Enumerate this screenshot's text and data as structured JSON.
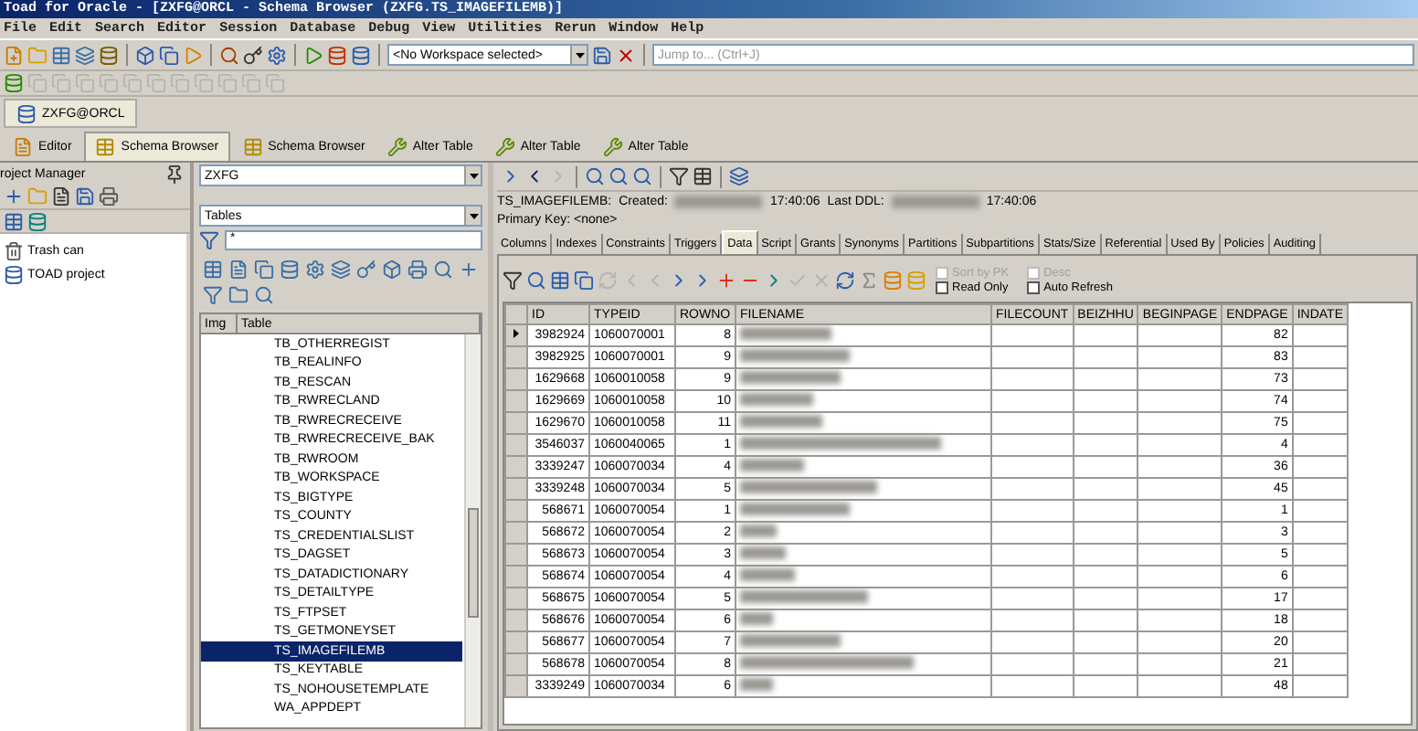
{
  "window": {
    "title": "Toad for Oracle - [ZXFG@ORCL - Schema Browser (ZXFG.TS_IMAGEFILEMB)]"
  },
  "menu": [
    "File",
    "Edit",
    "Search",
    "Editor",
    "Session",
    "Database",
    "Debug",
    "View",
    "Utilities",
    "Rerun",
    "Window",
    "Help"
  ],
  "toolbar": {
    "workspace": "<No Workspace selected>",
    "jump_placeholder": "Jump to... (Ctrl+J)"
  },
  "connection_tab": "ZXFG@ORCL",
  "doc_tabs": [
    {
      "label": "Editor",
      "kind": "editor",
      "selected": false
    },
    {
      "label": "Schema Browser",
      "kind": "schema",
      "selected": true
    },
    {
      "label": "Schema Browser",
      "kind": "schema",
      "selected": false
    },
    {
      "label": "Alter Table",
      "kind": "alter",
      "selected": false
    },
    {
      "label": "Alter Table",
      "kind": "alter",
      "selected": false
    },
    {
      "label": "Alter Table",
      "kind": "alter",
      "selected": false
    }
  ],
  "project_manager": {
    "title": "roject Manager",
    "items": [
      {
        "label": "Trash can",
        "kind": "trash"
      },
      {
        "label": "TOAD project",
        "kind": "project"
      }
    ]
  },
  "browser": {
    "schema": "ZXFG",
    "object_type": "Tables",
    "filter": "*",
    "columns": [
      "Img",
      "Table"
    ],
    "tables": [
      {
        "name": "TB_OTHERREGIST",
        "selected": false
      },
      {
        "name": "TB_REALINFO",
        "selected": false
      },
      {
        "name": "TB_RESCAN",
        "selected": false
      },
      {
        "name": "TB_RWRECLAND",
        "selected": false
      },
      {
        "name": "TB_RWRECRECEIVE",
        "selected": false
      },
      {
        "name": "TB_RWRECRECEIVE_BAK",
        "selected": false
      },
      {
        "name": "TB_RWROOM",
        "selected": false
      },
      {
        "name": "TB_WORKSPACE",
        "selected": false
      },
      {
        "name": "TS_BIGTYPE",
        "selected": false
      },
      {
        "name": "TS_COUNTY",
        "selected": false
      },
      {
        "name": "TS_CREDENTIALSLIST",
        "selected": false
      },
      {
        "name": "TS_DAGSET",
        "selected": false
      },
      {
        "name": "TS_DATADICTIONARY",
        "selected": false
      },
      {
        "name": "TS_DETAILTYPE",
        "selected": false
      },
      {
        "name": "TS_FTPSET",
        "selected": false
      },
      {
        "name": "TS_GETMONEYSET",
        "selected": false
      },
      {
        "name": "TS_IMAGEFILEMB",
        "selected": true
      },
      {
        "name": "TS_KEYTABLE",
        "selected": false
      },
      {
        "name": "TS_NOHOUSETEMPLATE",
        "selected": false
      },
      {
        "name": "WA_APPDEPT",
        "selected": false
      }
    ]
  },
  "details": {
    "object": "TS_IMAGEFILEMB:",
    "created_label": "Created:",
    "created_time": "17:40:06",
    "ddl_label": "Last DDL:",
    "ddl_time": "17:40:06",
    "primary_key": "Primary Key:  <none>",
    "tabs": [
      {
        "label": "Columns",
        "selected": false
      },
      {
        "label": "Indexes",
        "selected": false
      },
      {
        "label": "Constraints",
        "selected": false
      },
      {
        "label": "Triggers",
        "selected": false
      },
      {
        "label": "Data",
        "selected": true
      },
      {
        "label": "Script",
        "selected": false
      },
      {
        "label": "Grants",
        "selected": false
      },
      {
        "label": "Synonyms",
        "selected": false
      },
      {
        "label": "Partitions",
        "selected": false
      },
      {
        "label": "Subpartitions",
        "selected": false
      },
      {
        "label": "Stats/Size",
        "selected": false
      },
      {
        "label": "Referential",
        "selected": false
      },
      {
        "label": "Used By",
        "selected": false
      },
      {
        "label": "Policies",
        "selected": false
      },
      {
        "label": "Auditing",
        "selected": false
      }
    ],
    "options": [
      {
        "label": "Sort by PK",
        "checked": false,
        "disabled": true
      },
      {
        "label": "Desc",
        "checked": false,
        "disabled": true
      },
      {
        "label": "Read Only",
        "checked": false,
        "disabled": false
      },
      {
        "label": "Auto Refresh",
        "checked": false,
        "disabled": false
      }
    ]
  },
  "grid": {
    "columns": [
      "ID",
      "TYPEID",
      "ROWNO",
      "FILENAME",
      "FILECOUNT",
      "BEIZHHU",
      "BEGINPAGE",
      "ENDPAGE",
      "INDATE"
    ],
    "rows": [
      {
        "id": "3982924",
        "typeid": "1060070001",
        "rowno": "8",
        "endpage": "82",
        "current": true
      },
      {
        "id": "3982925",
        "typeid": "1060070001",
        "rowno": "9",
        "endpage": "83",
        "current": false
      },
      {
        "id": "1629668",
        "typeid": "1060010058",
        "rowno": "9",
        "endpage": "73",
        "current": false
      },
      {
        "id": "1629669",
        "typeid": "1060010058",
        "rowno": "10",
        "endpage": "74",
        "current": false
      },
      {
        "id": "1629670",
        "typeid": "1060010058",
        "rowno": "11",
        "endpage": "75",
        "current": false
      },
      {
        "id": "3546037",
        "typeid": "1060040065",
        "rowno": "1",
        "endpage": "4",
        "current": false
      },
      {
        "id": "3339247",
        "typeid": "1060070034",
        "rowno": "4",
        "endpage": "36",
        "current": false
      },
      {
        "id": "3339248",
        "typeid": "1060070034",
        "rowno": "5",
        "endpage": "45",
        "current": false
      },
      {
        "id": "568671",
        "typeid": "1060070054",
        "rowno": "1",
        "endpage": "1",
        "current": false
      },
      {
        "id": "568672",
        "typeid": "1060070054",
        "rowno": "2",
        "endpage": "3",
        "current": false
      },
      {
        "id": "568673",
        "typeid": "1060070054",
        "rowno": "3",
        "endpage": "5",
        "current": false
      },
      {
        "id": "568674",
        "typeid": "1060070054",
        "rowno": "4",
        "endpage": "6",
        "current": false
      },
      {
        "id": "568675",
        "typeid": "1060070054",
        "rowno": "5",
        "endpage": "17",
        "current": false
      },
      {
        "id": "568676",
        "typeid": "1060070054",
        "rowno": "6",
        "endpage": "18",
        "current": false
      },
      {
        "id": "568677",
        "typeid": "1060070054",
        "rowno": "7",
        "endpage": "20",
        "current": false
      },
      {
        "id": "568678",
        "typeid": "1060070054",
        "rowno": "8",
        "endpage": "21",
        "current": false
      },
      {
        "id": "3339249",
        "typeid": "1060070034",
        "rowno": "6",
        "endpage": "48",
        "current": false
      }
    ]
  }
}
